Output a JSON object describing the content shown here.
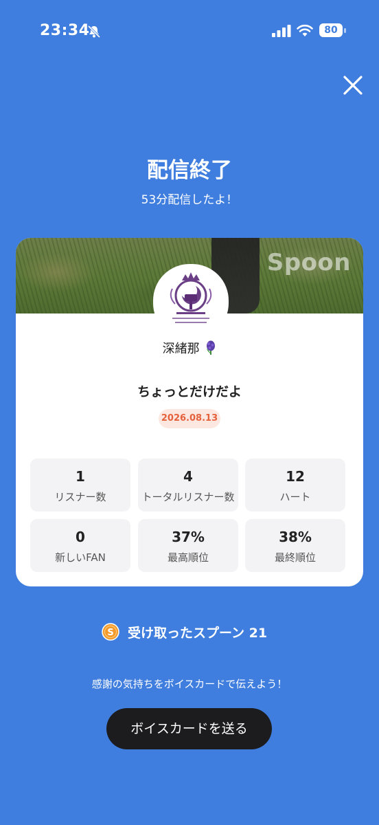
{
  "status_bar": {
    "time": "23:34",
    "battery": "80"
  },
  "header": {
    "title": "配信終了",
    "subtitle": "53分配信したよ！"
  },
  "card": {
    "cover_logo": "Spoon",
    "username": "深緒那",
    "broadcast_title": "ちょっとだけだよ",
    "date": "2026.08.13",
    "stats": [
      {
        "value": "1",
        "label": "リスナー数"
      },
      {
        "value": "4",
        "label": "トータルリスナー数"
      },
      {
        "value": "12",
        "label": "ハート"
      },
      {
        "value": "0",
        "label": "新しいFAN"
      },
      {
        "value": "37%",
        "label": "最高順位"
      },
      {
        "value": "38%",
        "label": "最終順位"
      }
    ]
  },
  "spoons": {
    "label": "受け取ったスプーン  21"
  },
  "hint": "感謝の気持ちをボイスカードで伝えよう！",
  "voice_card_button": "ボイスカードを送る",
  "colors": {
    "background": "#3f7ede",
    "badge_text": "#e5613b",
    "button": "#1c1c1e"
  },
  "icons": [
    "bell-slash-icon",
    "signal-icon",
    "wifi-icon",
    "battery-icon",
    "close-icon",
    "hyacinth-icon",
    "spoon-coin-icon"
  ]
}
